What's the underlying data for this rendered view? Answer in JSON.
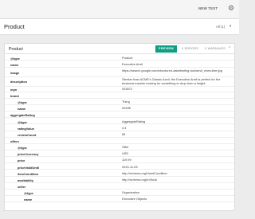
{
  "topbar": {
    "new_test_label": "NEW TEST",
    "settings_icon": "gear-icon"
  },
  "header": {
    "title": "Product",
    "filter_label": "All (1)"
  },
  "card": {
    "title": "Product",
    "preview_label": "PREVIEW",
    "errors_label": "0 ERRORS",
    "warnings_label": "0 WARNINGS"
  },
  "rows": [
    {
      "key": "@type",
      "value": "Product",
      "level": 0
    },
    {
      "key": "name",
      "value": "Executive Anvil",
      "level": 0
    },
    {
      "key": "image",
      "value": "https://search.google.com/structured-data/testing-tool/anvil_executive.jpg",
      "level": 0
    },
    {
      "key": "description",
      "value": "Sleeker than ACME's Classic Anvil, the Executive Anvil is perfect for the business traveler looking for something to drop from a height.",
      "level": 0
    },
    {
      "key": "mpn",
      "value": "925872",
      "level": 0
    },
    {
      "key": "brand",
      "value": "",
      "level": 0
    },
    {
      "key": "@type",
      "value": "Thing",
      "level": 1
    },
    {
      "key": "name",
      "value": "ACME",
      "level": 1
    },
    {
      "key": "aggregateRating",
      "value": "",
      "level": 0
    },
    {
      "key": "@type",
      "value": "AggregateRating",
      "level": 1
    },
    {
      "key": "ratingValue",
      "value": "4.4",
      "level": 1
    },
    {
      "key": "reviewCount",
      "value": "89",
      "level": 1
    },
    {
      "key": "offers",
      "value": "",
      "level": 0
    },
    {
      "key": "@type",
      "value": "Offer",
      "level": 1
    },
    {
      "key": "priceCurrency",
      "value": "USD",
      "level": 1
    },
    {
      "key": "price",
      "value": "119.99",
      "level": 1
    },
    {
      "key": "priceValidUntil",
      "value": "2020-11-05",
      "level": 1
    },
    {
      "key": "itemCondition",
      "value": "http://schema.org/UsedCondition",
      "level": 1
    },
    {
      "key": "availability",
      "value": "http://schema.org/InStock",
      "level": 1
    },
    {
      "key": "seller",
      "value": "",
      "level": 1
    },
    {
      "key": "@type",
      "value": "Organization",
      "level": 2
    },
    {
      "key": "name",
      "value": "Executive Objects",
      "level": 2
    }
  ]
}
